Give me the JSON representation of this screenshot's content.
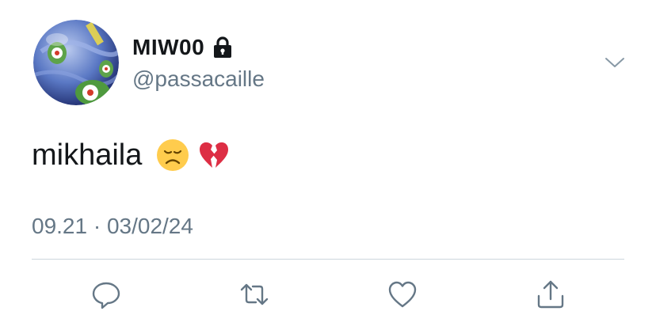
{
  "tweet": {
    "display_name": "MIW00",
    "handle": "@passacaille",
    "text": "mikhaila",
    "emojis": [
      "disappointed-face",
      "broken-heart"
    ],
    "timestamp": "09.21 · 03/02/24",
    "protected": true
  },
  "icons": {
    "avatar": "glass-marble-avatar",
    "lock": "lock-icon",
    "menu": "chevron-down-icon",
    "actions": [
      "reply-icon",
      "retweet-icon",
      "like-icon",
      "share-icon"
    ]
  },
  "colors": {
    "text": "#14171a",
    "secondary": "#657786",
    "divider": "#ccd6dd"
  }
}
